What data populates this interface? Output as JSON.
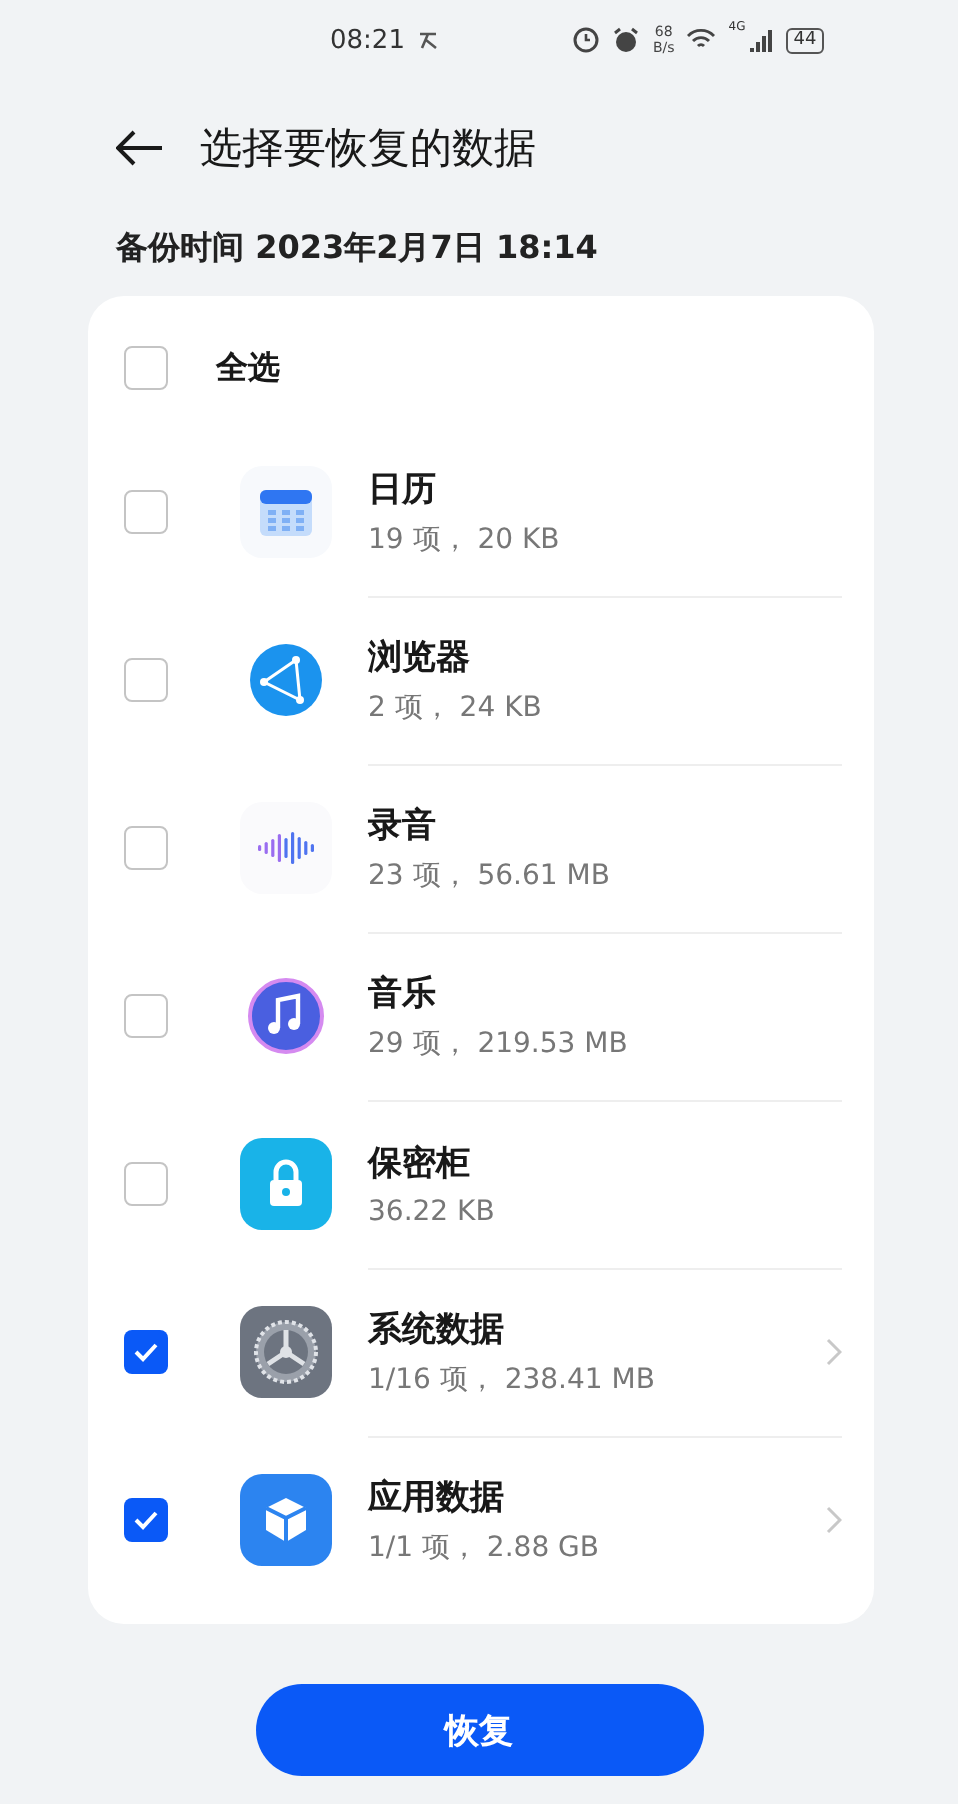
{
  "status_bar": {
    "time": "08:21",
    "speed_value": "68",
    "speed_unit": "B/s",
    "network": "4G",
    "battery": "44"
  },
  "header": {
    "title": "选择要恢复的数据"
  },
  "backup_time": "备份时间 2023年2月7日 18:14",
  "select_all": {
    "label": "全选",
    "checked": false
  },
  "items": [
    {
      "kind": "calendar",
      "name": "日历",
      "detail": "19 项， 20 KB",
      "checked": false,
      "has_details": false
    },
    {
      "kind": "browser",
      "name": "浏览器",
      "detail": "2 项， 24 KB",
      "checked": false,
      "has_details": false
    },
    {
      "kind": "recorder",
      "name": "录音",
      "detail": "23 项， 56.61 MB",
      "checked": false,
      "has_details": false
    },
    {
      "kind": "music",
      "name": "音乐",
      "detail": "29 项， 219.53 MB",
      "checked": false,
      "has_details": false
    },
    {
      "kind": "vault",
      "name": "保密柜",
      "detail": "36.22 KB",
      "checked": false,
      "has_details": false
    },
    {
      "kind": "settings",
      "name": "系统数据",
      "detail": "1/16 项， 238.41 MB",
      "checked": true,
      "has_details": true
    },
    {
      "kind": "apps",
      "name": "应用数据",
      "detail": "1/1 项， 2.88 GB",
      "checked": true,
      "has_details": true
    }
  ],
  "restore_button": "恢复"
}
